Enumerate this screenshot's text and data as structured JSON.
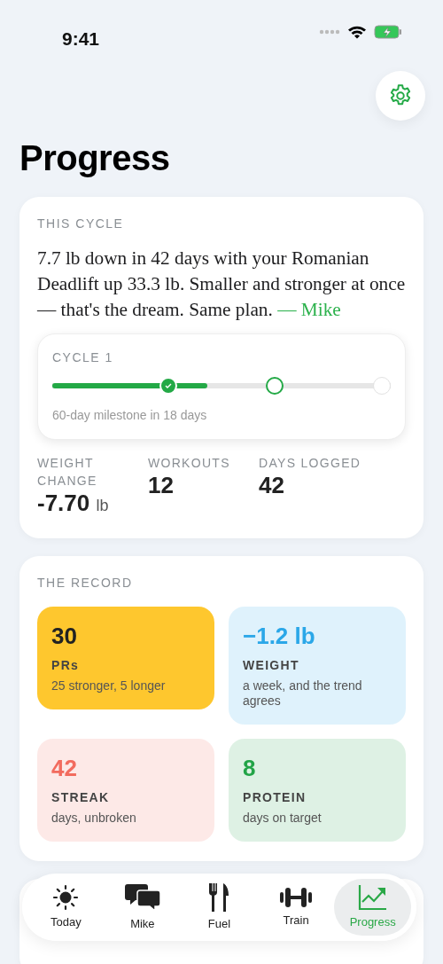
{
  "status_bar": {
    "time": "9:41"
  },
  "title": "Progress",
  "cycle_card": {
    "label": "THIS CYCLE",
    "quote": "7.7 lb down in 42 days with your Romanian Deadlift up 33.3 lb. Smaller and stronger at once — that's the dream. Same plan.",
    "attribution": "— Mike",
    "cycle": {
      "label": "CYCLE 1",
      "level": 0.455,
      "milestones": [
        {
          "kind": "done"
        },
        {
          "kind": "next"
        },
        {
          "kind": "upcoming"
        }
      ],
      "caption": "60-day milestone in 18 days"
    },
    "stats": [
      {
        "label": "WEIGHT CHANGE",
        "value": "-7.70",
        "unit": "lb"
      },
      {
        "label": "WORKOUTS",
        "value": "12"
      },
      {
        "label": "DAYS LOGGED",
        "value": "42"
      }
    ]
  },
  "record_card": {
    "label": "THE RECORD",
    "tiles": [
      {
        "value": "30",
        "label": "PRs",
        "note": "25 stronger, 5 longer",
        "color": "#fec72e"
      },
      {
        "value": "−1.2 lb",
        "label": "WEIGHT",
        "note": "a week, and the trend agrees",
        "color": "#2aa7e8"
      },
      {
        "value": "42",
        "label": "STREAK",
        "note": "days, unbroken",
        "color": "#f26b5e"
      },
      {
        "value": "8",
        "label": "PROTEIN",
        "note": "days on target",
        "color": "#22a447"
      }
    ]
  },
  "tabs": [
    {
      "label": "Today",
      "selected": false
    },
    {
      "label": "Mike",
      "selected": false
    },
    {
      "label": "Fuel",
      "selected": false
    },
    {
      "label": "Train",
      "selected": false
    },
    {
      "label": "Progress",
      "selected": true
    }
  ]
}
